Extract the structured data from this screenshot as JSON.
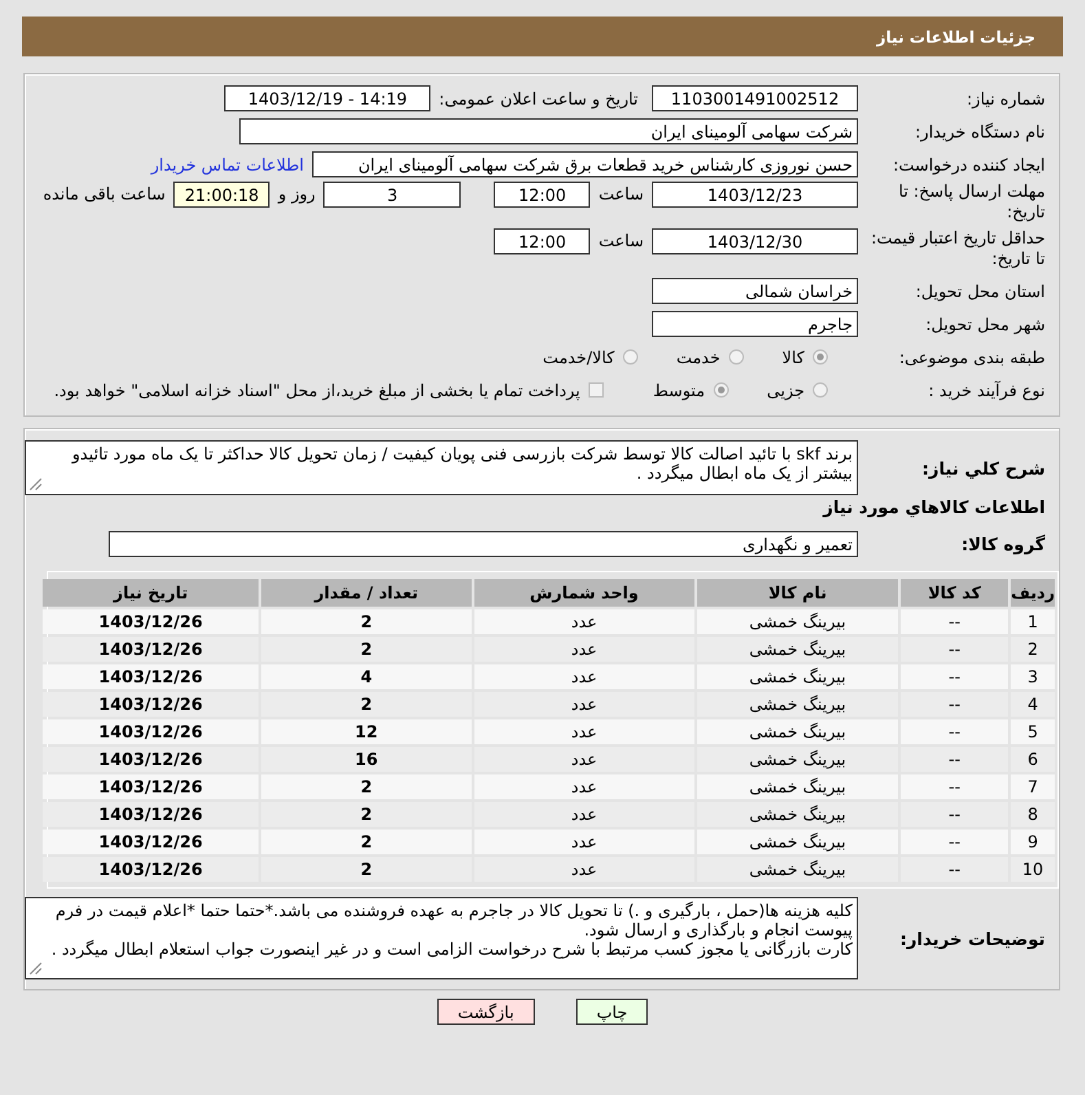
{
  "header": {
    "title": "جزئیات اطلاعات نیاز"
  },
  "form": {
    "need_number": {
      "label": "شماره نیاز:",
      "value": "1103001491002512"
    },
    "announce": {
      "label": "تاریخ و ساعت اعلان عمومی:",
      "value": "1403/12/19 - 14:19"
    },
    "buyer": {
      "label": "نام دستگاه خریدار:",
      "value": "شرکت سهامی آلومینای ایران"
    },
    "creator": {
      "label": "ایجاد کننده درخواست:",
      "value": "حسن نوروزی کارشناس خرید قطعات برق شرکت سهامی آلومینای ایران",
      "link": "اطلاعات تماس خریدار"
    },
    "deadline": {
      "label": "مهلت ارسال پاسخ: تا تاریخ:",
      "date": "1403/12/23",
      "time_label": "ساعت",
      "time": "12:00",
      "days": "3",
      "days_label": "روز و",
      "remaining": "21:00:18",
      "remaining_label": "ساعت باقی مانده"
    },
    "validity": {
      "label": "حداقل تاریخ اعتبار قیمت: تا تاریخ:",
      "date": "1403/12/30",
      "time_label": "ساعت",
      "time": "12:00"
    },
    "province": {
      "label": "استان محل تحویل:",
      "value": "خراسان شمالی"
    },
    "city": {
      "label": "شهر محل تحویل:",
      "value": "جاجرم"
    },
    "category": {
      "label": "طبقه بندی موضوعی:",
      "options": [
        {
          "label": "کالا",
          "selected": true
        },
        {
          "label": "خدمت",
          "selected": false
        },
        {
          "label": "کالا/خدمت",
          "selected": false
        }
      ]
    },
    "process": {
      "label": "نوع فرآیند خرید :",
      "options": [
        {
          "label": "جزیی",
          "selected": false
        },
        {
          "label": "متوسط",
          "selected": true
        }
      ],
      "payment": {
        "label": "پرداخت تمام یا بخشی از مبلغ خرید،از محل \"اسناد خزانه اسلامی\" خواهد بود.",
        "checked": false
      }
    }
  },
  "details": {
    "description": {
      "label": "شرح کلي نياز:",
      "value": "برند skf  با تائید اصالت کالا توسط شرکت بازرسی فنی پویان کیفیت / زمان تحویل کالا حداکثر تا یک ماه مورد تائیدو بیشتر از یک ماه  ابطال میگردد ."
    },
    "goods_title": "اطلاعات کالاهاي مورد نياز",
    "group": {
      "label": "گروه کالا:",
      "value": "تعمیر و نگهداری"
    },
    "table": {
      "columns": [
        "ردیف",
        "کد کالا",
        "نام کالا",
        "واحد شمارش",
        "تعداد / مقدار",
        "تاریخ نیاز"
      ],
      "rows": [
        [
          "1",
          "--",
          "بیرینگ خمشی",
          "عدد",
          "2",
          "1403/12/26"
        ],
        [
          "2",
          "--",
          "بیرینگ خمشی",
          "عدد",
          "2",
          "1403/12/26"
        ],
        [
          "3",
          "--",
          "بیرینگ خمشی",
          "عدد",
          "4",
          "1403/12/26"
        ],
        [
          "4",
          "--",
          "بیرینگ خمشی",
          "عدد",
          "2",
          "1403/12/26"
        ],
        [
          "5",
          "--",
          "بیرینگ خمشی",
          "عدد",
          "12",
          "1403/12/26"
        ],
        [
          "6",
          "--",
          "بیرینگ خمشی",
          "عدد",
          "16",
          "1403/12/26"
        ],
        [
          "7",
          "--",
          "بیرینگ خمشی",
          "عدد",
          "2",
          "1403/12/26"
        ],
        [
          "8",
          "--",
          "بیرینگ خمشی",
          "عدد",
          "2",
          "1403/12/26"
        ],
        [
          "9",
          "--",
          "بیرینگ خمشی",
          "عدد",
          "2",
          "1403/12/26"
        ],
        [
          "10",
          "--",
          "بیرینگ خمشی",
          "عدد",
          "2",
          "1403/12/26"
        ]
      ]
    },
    "notes": {
      "label": "توضیحات خریدار:",
      "paragraphs": [
        "کلیه هزینه ها(حمل ، بارگیری و .) تا تحویل کالا در جاجرم به عهده فروشنده می باشد.*حتما حتما *اعلام قیمت در فرم پیوست انجام و بارگذاری و ارسال شود.",
        "کارت بازرگانی یا مجوز کسب مرتبط با شرح درخواست الزامی است و در غیر اینصورت جواب استعلام ابطال میگردد ."
      ]
    }
  },
  "buttons": [
    {
      "label": "چاپ",
      "kind": "print"
    },
    {
      "label": "بازگشت",
      "kind": "back"
    }
  ]
}
